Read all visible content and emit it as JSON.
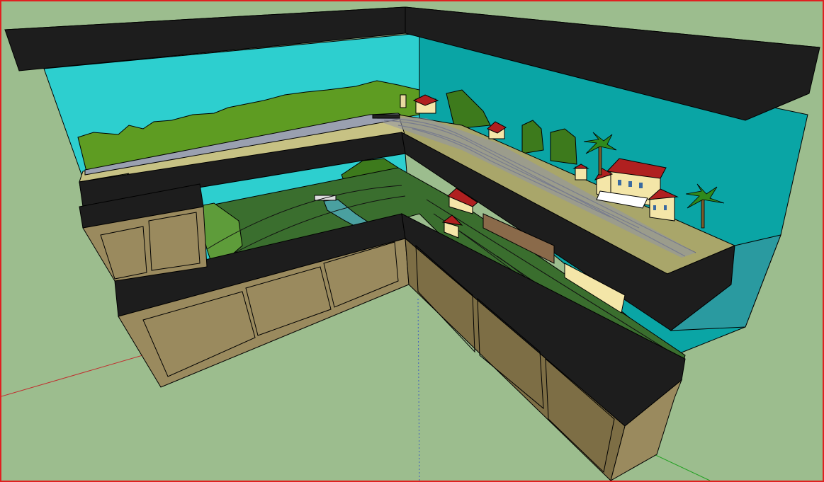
{
  "scene": {
    "description_visible_text": "",
    "colors": {
      "ground": "#9cbd8e",
      "viewport_border": "#e02020",
      "fascia": "#1d1d1d",
      "fascia_top": "#c8c8c8",
      "sky_left": "#2dcfcf",
      "sky_right": "#0aa5a5",
      "cabinet_front": "#9a8a5e",
      "cabinet_side": "#7d6e45",
      "grass_lower": "#3a6e2e",
      "grass_upper": "#a9a66a",
      "backdrop_trees": "#5e9c22",
      "water": "#1c2fc8",
      "track_ballast": "#8f93a8",
      "roof_red": "#b02020",
      "wall_cream": "#f4e6a8"
    },
    "axes": {
      "red": "#c03030",
      "green": "#20a020",
      "blue": "#4060c0"
    },
    "objects": [
      "upper-fascia",
      "middle-fascia",
      "lower-fascia",
      "backdrop-left",
      "backdrop-right",
      "cabinet-left",
      "cabinet-right",
      "station-building",
      "palm-trees",
      "houses"
    ]
  }
}
